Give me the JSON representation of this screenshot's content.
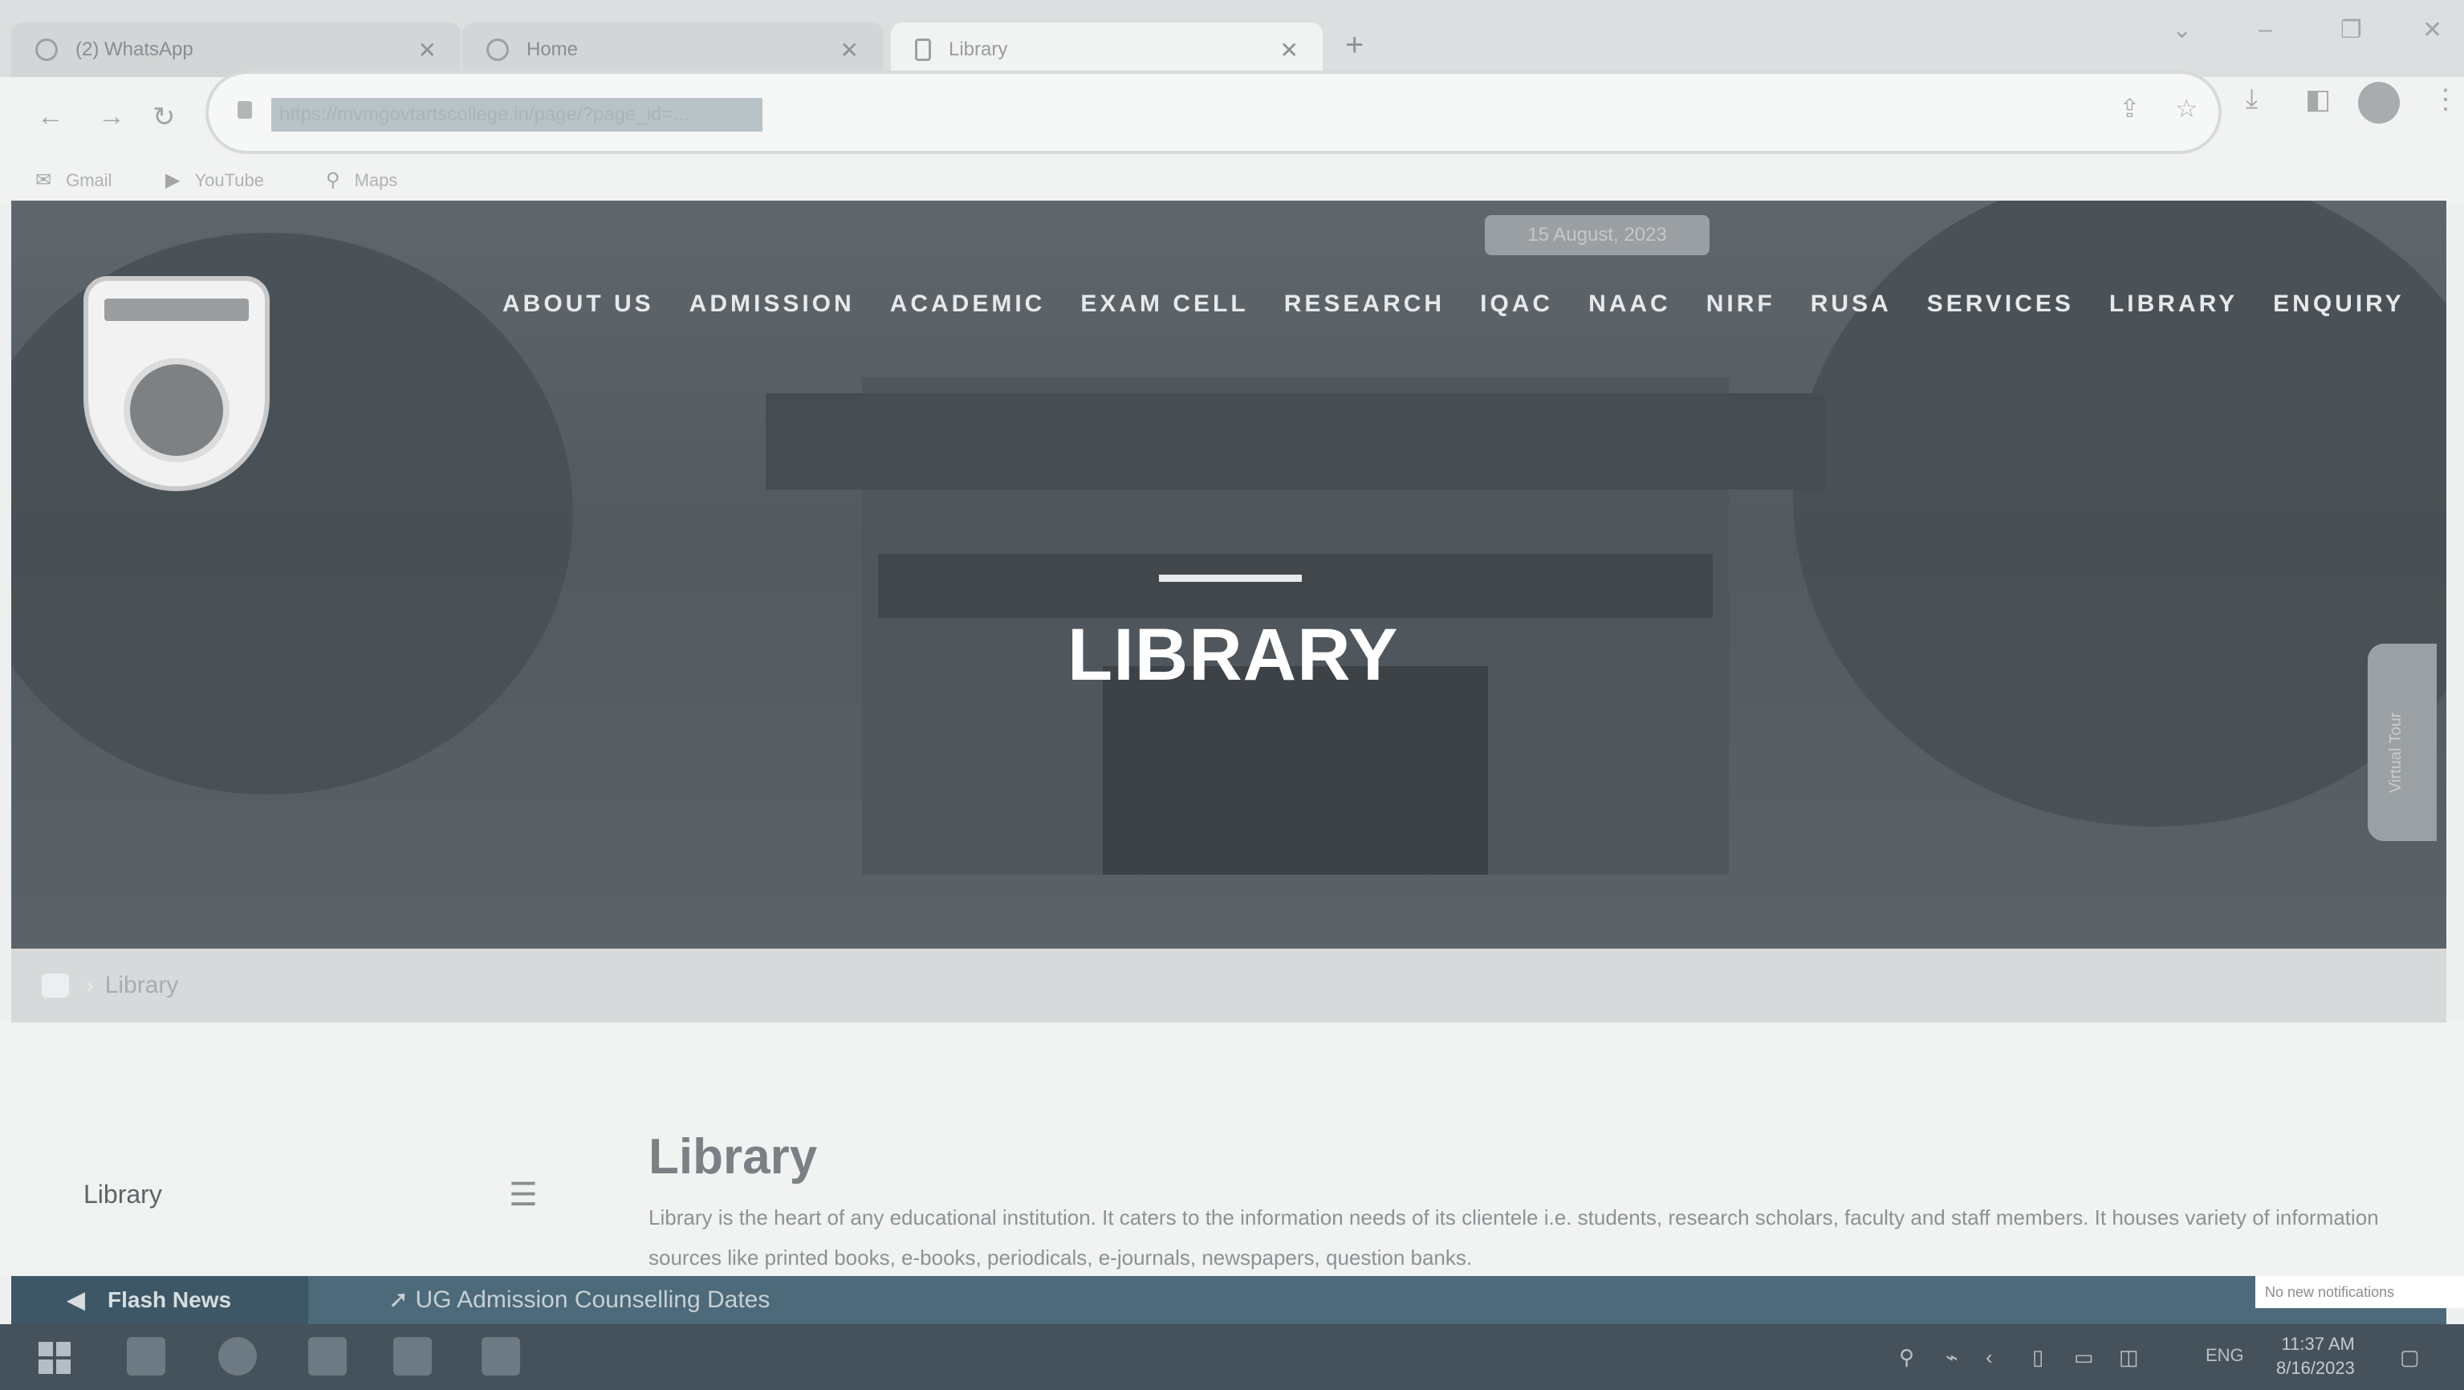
{
  "browser": {
    "tabs": [
      {
        "title": "(2) WhatsApp",
        "active": false
      },
      {
        "title": "Home",
        "active": false
      },
      {
        "title": "Library",
        "active": true
      }
    ],
    "new_tab_label": "+",
    "address": {
      "url": "https://mvmgovtartscollege.in/page/?page_id=..."
    },
    "bookmarks": [
      {
        "label": "Gmail",
        "icon": "gmail-icon"
      },
      {
        "label": "YouTube",
        "icon": "youtube-icon"
      },
      {
        "label": "Maps",
        "icon": "maps-icon"
      }
    ]
  },
  "site": {
    "date_badge": "15 August, 2023",
    "nav": [
      "ABOUT US",
      "ADMISSION",
      "ACADEMIC",
      "EXAM CELL",
      "RESEARCH",
      "IQAC",
      "NAAC",
      "NIRF",
      "RUSA",
      "SERVICES",
      "LIBRARY",
      "ENQUIRY"
    ],
    "hero_title": "LIBRARY",
    "side_tab_label": "Virtual Tour",
    "breadcrumb_current": "Library",
    "sidebar_label": "Library",
    "article": {
      "title": "Library",
      "body": "Library is the heart of any educational institution. It caters to the information needs of its clientele i.e. students, research scholars, faculty and staff members. It houses variety of information sources like printed books, e-books, periodicals, e-journals, newspapers, question banks."
    },
    "flash": {
      "label": "Flash News",
      "text": "UG Admission Counselling Dates"
    },
    "notification": "No new notifications"
  },
  "taskbar": {
    "language": "ENG",
    "time": "11:37 AM",
    "date": "8/16/2023"
  }
}
